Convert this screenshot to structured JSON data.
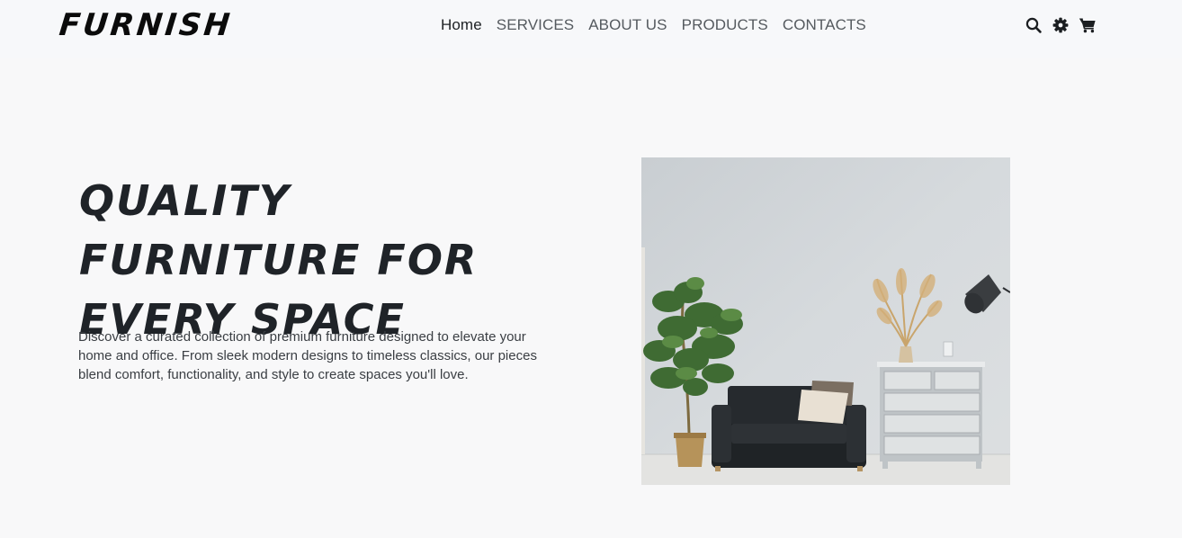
{
  "brand": {
    "logo_text": "FURNISH"
  },
  "nav": {
    "links": [
      {
        "label": "Home",
        "active": true
      },
      {
        "label": "SERVICES",
        "active": false
      },
      {
        "label": "ABOUT US",
        "active": false
      },
      {
        "label": "PRODUCTS",
        "active": false
      },
      {
        "label": "CONTACTS",
        "active": false
      }
    ],
    "icons": [
      "search-icon",
      "gear-icon",
      "cart-icon"
    ]
  },
  "hero": {
    "title": "QUALITY FURNITURE FOR EVERY SPACE",
    "description": "Discover a curated collection of premium furniture designed to elevate your home and office. From sleek modern designs to timeless classics, our pieces blend comfort, functionality, and style to create spaces you'll love.",
    "image_subject": "living room with black sofa, potted plant, white dresser and floor lamp"
  },
  "colors": {
    "background": "#f8f8f9",
    "navbar_bg": "#f7f8fa",
    "text_dark": "#1f2328",
    "nav_text": "#555a5f"
  }
}
